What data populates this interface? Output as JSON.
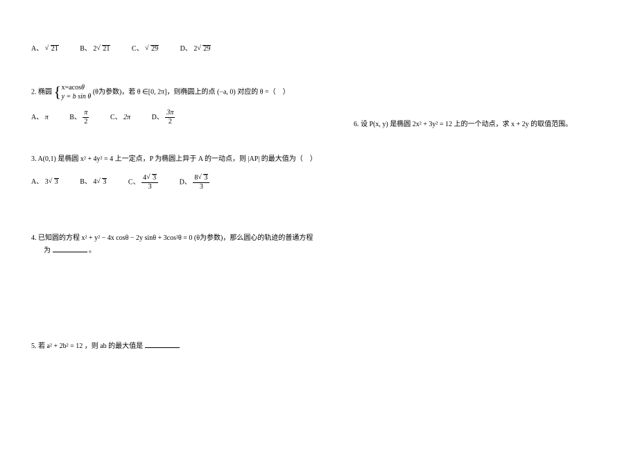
{
  "problems": {
    "p1": {
      "options": {
        "A": {
          "label": "A、",
          "value": "21"
        },
        "B": {
          "label": "B、",
          "coef": "2",
          "value": "21"
        },
        "C": {
          "label": "C、",
          "value": "29"
        },
        "D": {
          "label": "D、",
          "coef": "2",
          "value": "29"
        }
      }
    },
    "p2": {
      "number": "2. 椭圆",
      "case1_prefix": "x=acos",
      "case2_eq": "y = b sin θ",
      "theta": "θ",
      "mid": "(θ为参数)，若 θ ∈[0, 2π]，则椭圆上的点 (−a, 0) 对应的 θ =（    ）",
      "options": {
        "A": {
          "label": "A、",
          "value": "π"
        },
        "B": {
          "label": "B、",
          "num": "π",
          "den": "2"
        },
        "C": {
          "label": "C、",
          "value": "2π"
        },
        "D": {
          "label": "D、",
          "num": "3π",
          "den": "2"
        }
      }
    },
    "p3": {
      "text": "3. A(0,1) 是椭圆 x² + 4y² = 4 上一定点，P 为椭圆上异于 A 的一动点，则 |AP| 的最大值为（    ）",
      "options": {
        "A": {
          "label": "A、",
          "coef": "3",
          "value": "3"
        },
        "B": {
          "label": "B、",
          "coef": "4",
          "value": "3"
        },
        "C": {
          "label": "C、",
          "num_coef": "4",
          "num_root": "3",
          "den": "3"
        },
        "D": {
          "label": "D、",
          "num_coef": "8",
          "num_root": "3",
          "den": "3"
        }
      }
    },
    "p4": {
      "line1": "4. 已知圆的方程 x² + y² − 4x cosθ − 2y sinθ + 3cos²θ = 0 (θ为参数)，那么圆心的轨迹的普通方程",
      "line2": "为",
      "period": "。"
    },
    "p5": {
      "text": "5. 若 a² + 2b² = 12 ，则 ab 的最大值是"
    },
    "p6": {
      "text": "6. 设 P(x, y) 是椭圆 2x² + 3y² = 12 上的一个动点，求 x + 2y 的取值范围。"
    }
  }
}
